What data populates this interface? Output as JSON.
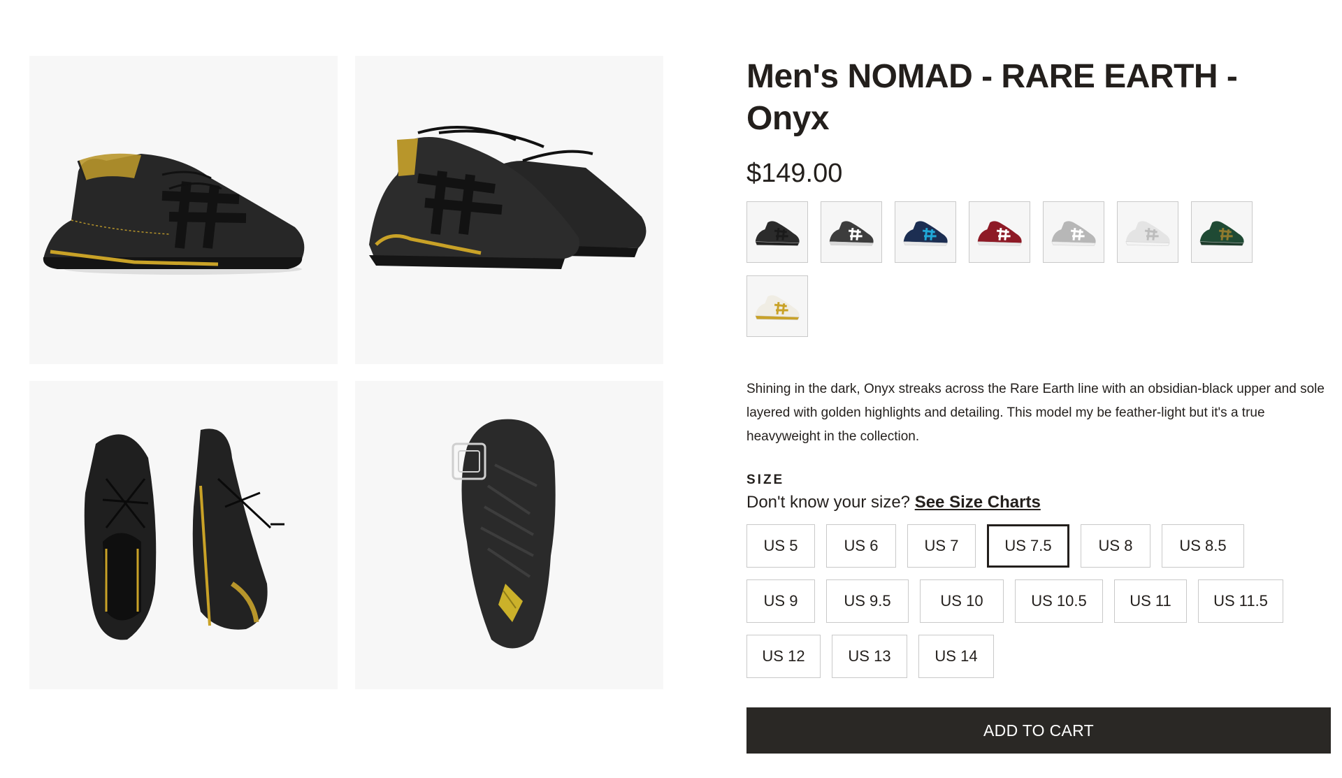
{
  "product": {
    "title": "Men's NOMAD - RARE EARTH - Onyx",
    "price": "$149.00",
    "description": "Shining in the dark, Onyx streaks across the Rare Earth line with an obsidian-black upper and sole layered with golden highlights and detailing. This model my be feather-light but it's a true heavyweight in the collection."
  },
  "gallery": [
    {
      "name": "side-view-image"
    },
    {
      "name": "pair-angle-view-image"
    },
    {
      "name": "top-view-image"
    },
    {
      "name": "sole-view-image"
    }
  ],
  "colorways": [
    {
      "name": "swatch-onyx",
      "upper": "#2b2b2b",
      "accent": "#1a1a1a",
      "sole": "#222222"
    },
    {
      "name": "swatch-charcoal-white",
      "upper": "#3d3d3d",
      "accent": "#ffffff",
      "sole": "#d9d9d9"
    },
    {
      "name": "swatch-navy-blue",
      "upper": "#1c2e52",
      "accent": "#20a8d8",
      "sole": "#e8e8e8"
    },
    {
      "name": "swatch-red",
      "upper": "#8e1a26",
      "accent": "#ffffff",
      "sole": "#e8e8e8"
    },
    {
      "name": "swatch-grey",
      "upper": "#b7b7b7",
      "accent": "#ffffff",
      "sole": "#eeeeee"
    },
    {
      "name": "swatch-white",
      "upper": "#e4e4e4",
      "accent": "#bdbdbd",
      "sole": "#f4f4f4"
    },
    {
      "name": "swatch-green",
      "upper": "#1f4a34",
      "accent": "#8f7a2e",
      "sole": "#1e3b2b"
    },
    {
      "name": "swatch-gold-white",
      "upper": "#f0ede4",
      "accent": "#c9a227",
      "sole": "#c9a227"
    }
  ],
  "size": {
    "heading": "SIZE",
    "help_text": "Don't know your size?",
    "help_link": "See Size Charts",
    "selected": "US 7.5",
    "options": [
      "US 5",
      "US 6",
      "US 7",
      "US 7.5",
      "US 8",
      "US 8.5",
      "US 9",
      "US 9.5",
      "US 10",
      "US 10.5",
      "US 11",
      "US 11.5",
      "US 12",
      "US 13",
      "US 14"
    ]
  },
  "cart": {
    "button_label": "ADD TO CART"
  },
  "colors": {
    "text": "#231f1c",
    "button": "#2a2825",
    "gold": "#c9a227",
    "shoe": "#1e1e1e"
  }
}
